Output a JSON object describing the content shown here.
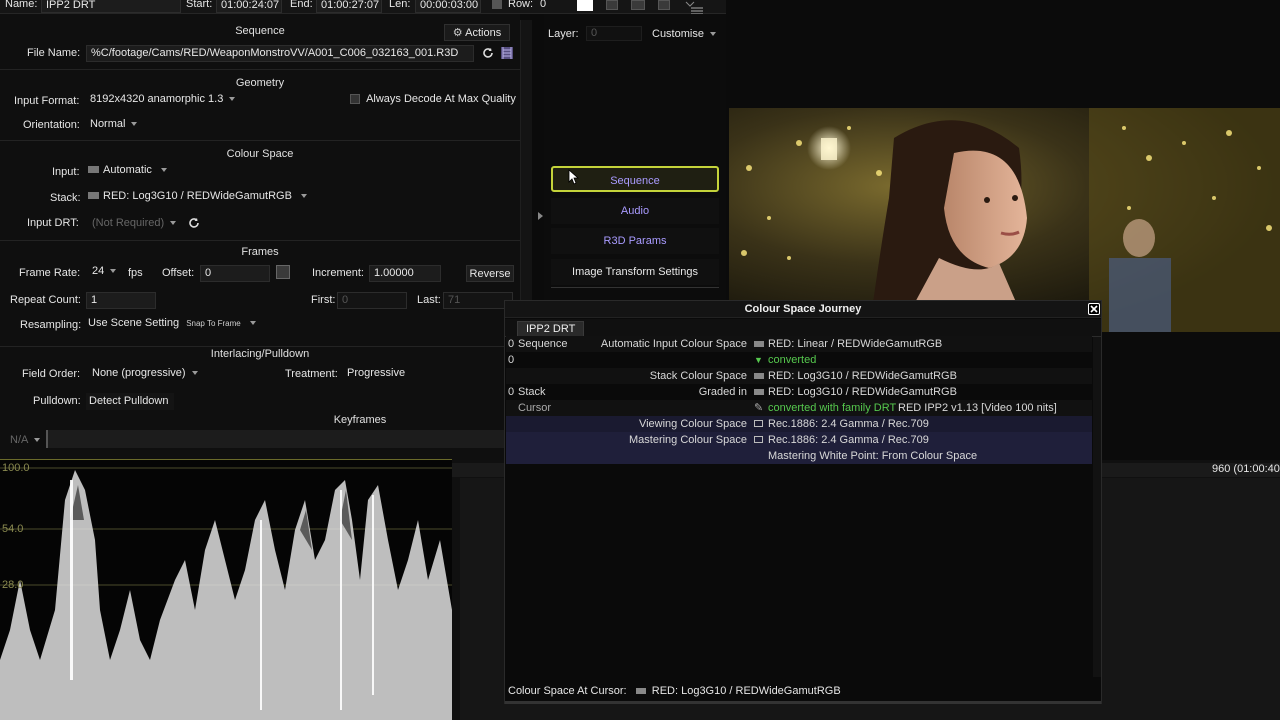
{
  "topbar": {
    "name_label": "Name:",
    "name_value": "IPP2 DRT",
    "start_label": "Start:",
    "start_value": "01:00:24:07",
    "end_label": "End:",
    "end_value": "01:00:27:07",
    "len_label": "Len:",
    "len_value": "00:00:03:00",
    "row_label": "Row:",
    "row_value": "0"
  },
  "sequence": {
    "header": "Sequence",
    "actions_label": "Actions",
    "file_name_label": "File Name:",
    "file_name_value": "%C/footage/Cams/RED/WeaponMonstroVV/A001_C006_032163_001.R3D"
  },
  "geometry": {
    "header": "Geometry",
    "input_format_label": "Input Format:",
    "input_format_value": "8192x4320 anamorphic 1.3",
    "always_decode_label": "Always Decode At Max Quality",
    "orientation_label": "Orientation:",
    "orientation_value": "Normal"
  },
  "colour_space": {
    "header": "Colour Space",
    "input_label": "Input:",
    "input_value": "Automatic",
    "stack_label": "Stack:",
    "stack_value": "RED: Log3G10 / REDWideGamutRGB",
    "input_drt_label": "Input DRT:",
    "input_drt_value": "(Not Required)"
  },
  "frames": {
    "header": "Frames",
    "frame_rate_label": "Frame Rate:",
    "frame_rate_value": "24",
    "fps_label": "fps",
    "offset_label": "Offset:",
    "offset_value": "0",
    "increment_label": "Increment:",
    "increment_value": "1.00000",
    "reverse_label": "Reverse",
    "repeat_count_label": "Repeat Count:",
    "repeat_count_value": "1",
    "first_label": "First:",
    "first_value": "0",
    "last_label": "Last:",
    "last_value": "71",
    "resampling_label": "Resampling:",
    "resampling_value": "Use Scene Setting",
    "snap_label": "Snap To Frame"
  },
  "interlacing": {
    "header": "Interlacing/Pulldown",
    "field_order_label": "Field Order:",
    "field_order_value": "None (progressive)",
    "treatment_label": "Treatment:",
    "treatment_value": "Progressive",
    "pulldown_label": "Pulldown:",
    "pulldown_value": "Detect Pulldown"
  },
  "keyframes": {
    "header": "Keyframes",
    "value": "N/A"
  },
  "right_panel": {
    "layer_label": "Layer:",
    "layer_value": "0",
    "customise_label": "Customise",
    "nav": [
      "Sequence",
      "Audio",
      "R3D Params",
      "Image Transform Settings"
    ]
  },
  "scope": {
    "ticks": [
      "100.0",
      "54.0",
      "28.0"
    ]
  },
  "timeline": {
    "frame_readout": "960 (01:00:40"
  },
  "dialog": {
    "title": "Colour Space Journey",
    "tab": "IPP2 DRT",
    "rows": [
      {
        "c1": "0",
        "c2": "Sequence",
        "c3": "Automatic Input Colour Space",
        "c4": "RED: Linear / REDWideGamutRGB"
      },
      {
        "c1": "0",
        "c2": "",
        "c3": "",
        "c4": "converted"
      },
      {
        "c1": "",
        "c2": "",
        "c3": "Stack Colour Space",
        "c4": "RED: Log3G10 / REDWideGamutRGB"
      },
      {
        "c1": "0",
        "c2": "Stack",
        "c3": "Graded in",
        "c4": "RED: Log3G10 / REDWideGamutRGB"
      },
      {
        "c1": "",
        "c2": "Cursor",
        "c3": "",
        "c4a": "converted with family DRT",
        "c4b": "RED IPP2 v1.13 [Video 100 nits]"
      },
      {
        "c1": "",
        "c2": "",
        "c3": "Viewing Colour Space",
        "c4": "Rec.1886: 2.4 Gamma / Rec.709"
      },
      {
        "c1": "",
        "c2": "",
        "c3": "Mastering Colour Space",
        "c4": "Rec.1886: 2.4 Gamma / Rec.709"
      },
      {
        "c1": "",
        "c2": "",
        "c3": "",
        "c4": "Mastering White Point: From Colour Space"
      }
    ],
    "footer_label": "Colour Space At Cursor:",
    "footer_value": "RED: Log3G10 / REDWideGamutRGB"
  },
  "colors": {
    "accent_green": "#56c94e",
    "nav_active": "#c4d33a",
    "nav_text": "#a99bff"
  }
}
